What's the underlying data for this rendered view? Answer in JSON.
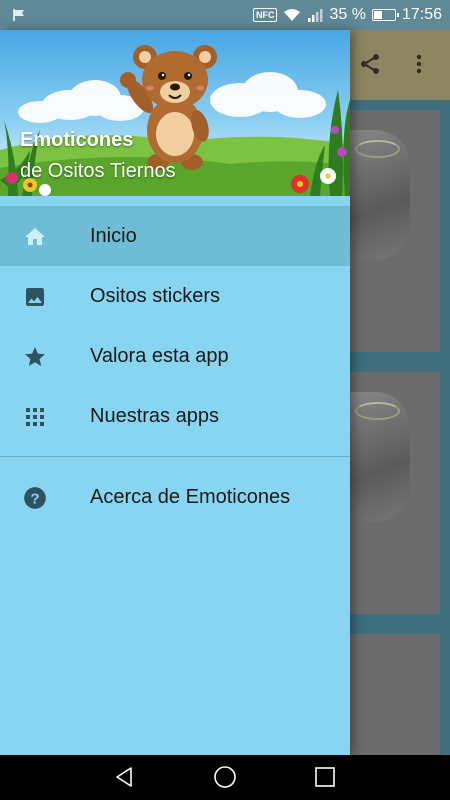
{
  "status_bar": {
    "battery_text": "35 %",
    "time": "17:56",
    "nfc_label": "NFC",
    "icons": [
      "flag-icon",
      "nfc-icon",
      "wifi-icon",
      "signal-icon",
      "battery-icon"
    ]
  },
  "background_app": {
    "toolbar_icons": [
      "share-icon",
      "more-vert-icon"
    ],
    "toolbar_color": "#8d8660"
  },
  "drawer": {
    "header": {
      "title": "Emoticones",
      "subtitle": "de Ositos Tiernos",
      "image": "bear-waving-illustration"
    },
    "items": [
      {
        "label": "Inicio",
        "icon": "home-icon",
        "active": true
      },
      {
        "label": "Ositos stickers",
        "icon": "image-icon",
        "active": false
      },
      {
        "label": "Valora esta app",
        "icon": "star-icon",
        "active": false
      },
      {
        "label": "Nuestras apps",
        "icon": "apps-grid-icon",
        "active": false
      }
    ],
    "secondary_items": [
      {
        "label": "Acerca de Emoticones",
        "icon": "help-icon"
      }
    ],
    "background_color": "#87d5f0",
    "active_color": "#6fbcd6"
  },
  "nav_bar": {
    "buttons": [
      "back-icon",
      "home-circle-icon",
      "recents-icon"
    ]
  }
}
